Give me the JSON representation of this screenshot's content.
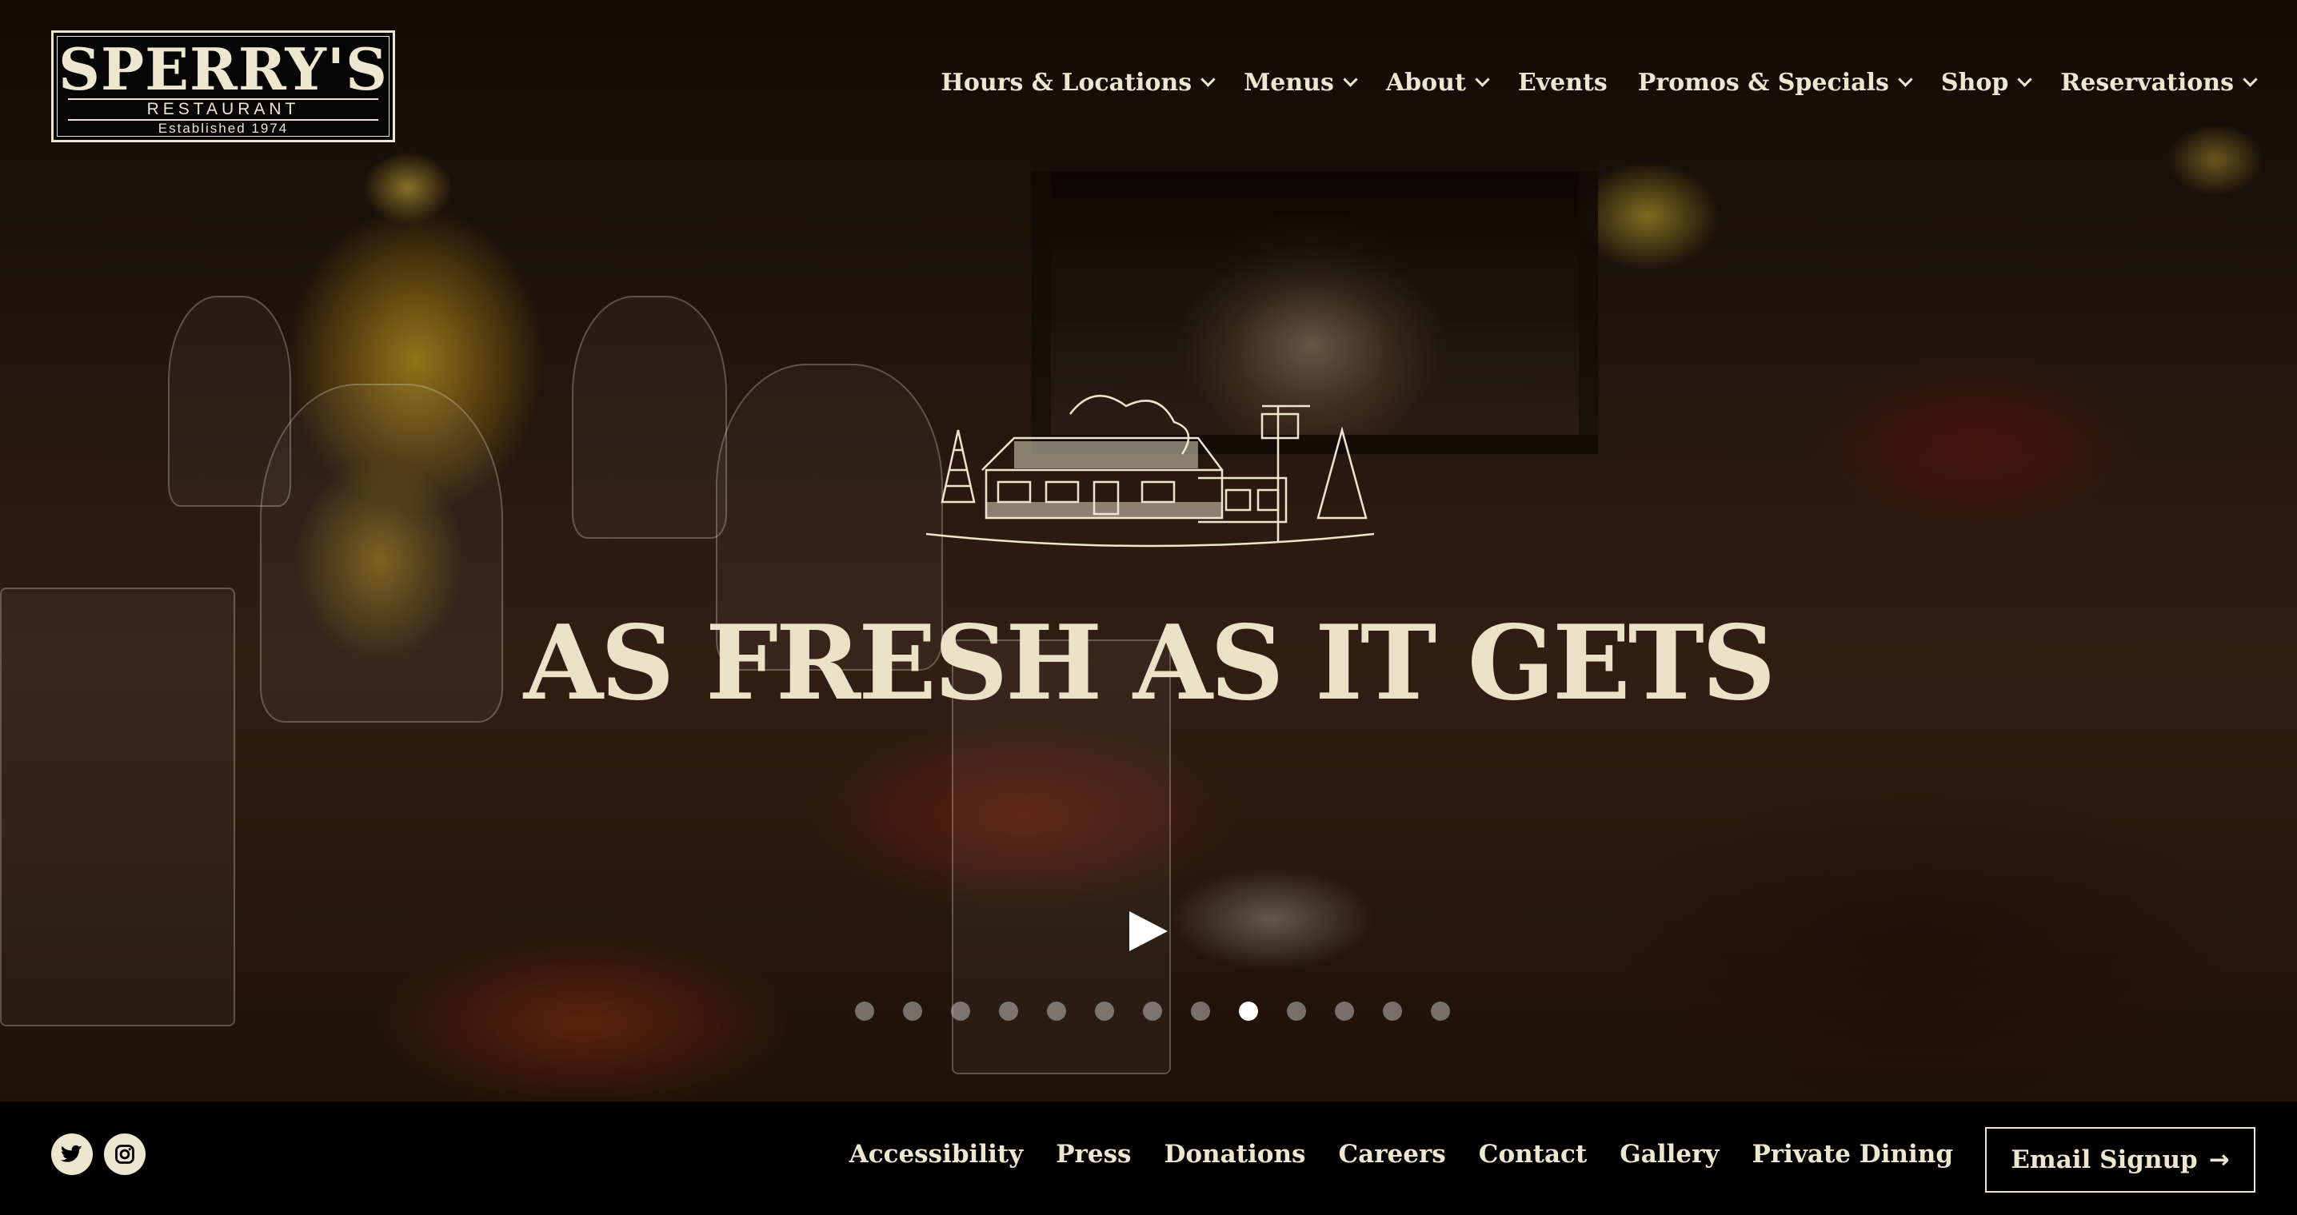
{
  "brand": {
    "name": "SPERRY'S",
    "subtitle": "RESTAURANT",
    "established": "Established 1974"
  },
  "nav": {
    "items": [
      {
        "label": "Hours & Locations",
        "dropdown": true
      },
      {
        "label": "Menus",
        "dropdown": true
      },
      {
        "label": "About",
        "dropdown": true
      },
      {
        "label": "Events",
        "dropdown": false
      },
      {
        "label": "Promos & Specials",
        "dropdown": true
      },
      {
        "label": "Shop",
        "dropdown": true
      },
      {
        "label": "Reservations",
        "dropdown": true
      }
    ]
  },
  "hero": {
    "headline": "AS FRESH AS IT GETS",
    "illustration": "restaurant-building-sketch",
    "slide_count": 13,
    "active_slide": 9
  },
  "footer": {
    "social": [
      {
        "name": "twitter-icon"
      },
      {
        "name": "instagram-icon"
      }
    ],
    "links": [
      "Accessibility",
      "Press",
      "Donations",
      "Careers",
      "Contact",
      "Gallery",
      "Private Dining"
    ],
    "email_signup": "Email Signup",
    "email_arrow": "→"
  },
  "colors": {
    "cream": "#efe6cf",
    "headline": "#ebe1c7",
    "footer_bg": "#000000"
  }
}
